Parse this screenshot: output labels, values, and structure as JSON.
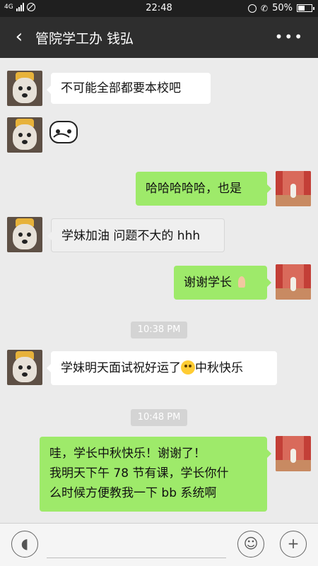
{
  "status": {
    "network": "4G",
    "time": "22:48",
    "battery": "50%"
  },
  "header": {
    "title": "管院学工办 钱弘"
  },
  "messages": [
    {
      "text": "不可能全部都要本校吧"
    },
    {
      "text": "哈哈哈哈哈，也是"
    },
    {
      "text": "学妹加油 问题不大的 hhh"
    },
    {
      "text": "谢谢学长"
    },
    {
      "time": "10:38 PM"
    },
    {
      "text_before_emoji": "学妹明天面试祝好运了",
      "text_after_emoji": "中秋快乐"
    },
    {
      "time": "10:48 PM"
    },
    {
      "lines": [
        "哇，学长中秋快乐！谢谢了！",
        "我明天下午 78 节有课，学长你什",
        "么时候方便教我一下 bb 系统啊"
      ]
    }
  ],
  "icons": {
    "back": "chevron-left-icon",
    "more": "more-icon",
    "voice": "voice-icon",
    "emoji": "emoji-icon",
    "add": "add-icon"
  },
  "colors": {
    "green_bubble": "#9eea6a",
    "title_bar": "#2e2e2e",
    "background": "#ebebeb"
  }
}
